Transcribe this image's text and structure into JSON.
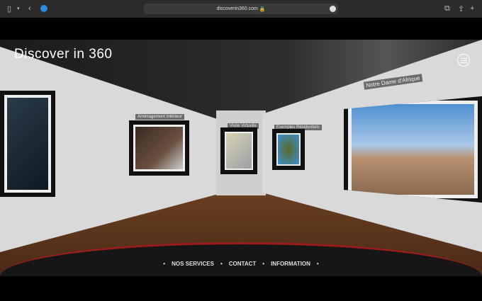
{
  "browser": {
    "url": "discoverin360.com"
  },
  "site": {
    "logo": "Discover in 360"
  },
  "gallery": [
    {
      "label": "Aménagement Intérieur"
    },
    {
      "label": "Visite Virtuelle"
    },
    {
      "label": "Exemples Résidentiels"
    },
    {
      "label": "Notre Dame d'Afrique"
    }
  ],
  "nav": {
    "items": [
      "NOS SERVICES",
      "CONTACT",
      "INFORMATION"
    ],
    "separator": "•"
  }
}
